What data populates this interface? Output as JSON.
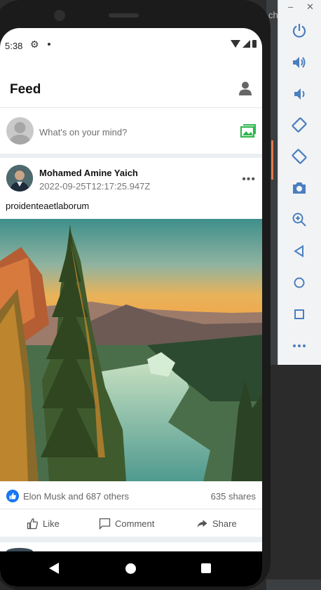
{
  "ide": {
    "fragment_text": "ch"
  },
  "status_bar": {
    "time": "5:38"
  },
  "app_bar": {
    "title": "Feed"
  },
  "composer": {
    "placeholder": "What's on your mind?"
  },
  "post": {
    "author": "Mohamed Amine Yaich",
    "timestamp": "2022-09-25T12:17:25.947Z",
    "text": "proidenteaetlaborum",
    "reactions_text": "Elon Musk and 687 others",
    "shares_text": "635 shares",
    "actions": {
      "like": "Like",
      "comment": "Comment",
      "share": "Share"
    }
  },
  "emulator": {
    "window_controls": {
      "minimize": "–",
      "close": "✕"
    },
    "buttons": [
      "power-icon",
      "volume-up-icon",
      "volume-down-icon",
      "rotate-left-icon",
      "rotate-right-icon",
      "camera-icon",
      "zoom-icon",
      "back-icon",
      "home-icon",
      "overview-icon",
      "more-icon"
    ]
  },
  "colors": {
    "accent": "#1877f2",
    "photo_green": "#2db84d",
    "emulator_icon": "#4a7fbf"
  }
}
